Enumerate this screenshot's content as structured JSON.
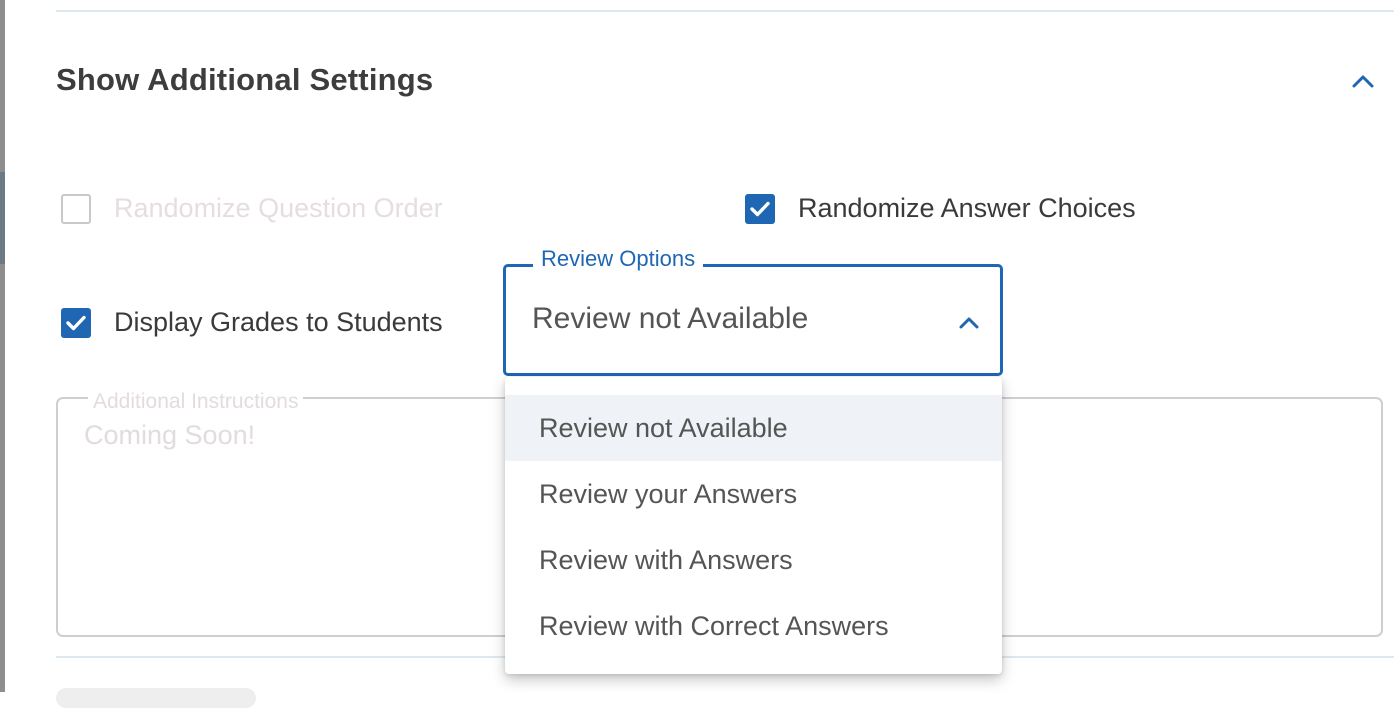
{
  "section": {
    "title": "Show Additional Settings",
    "collapse_icon": "chevron-up-icon"
  },
  "options": {
    "randomize_question_order": {
      "label": "Randomize Question Order",
      "checked": false,
      "disabled": true
    },
    "randomize_answer_choices": {
      "label": "Randomize Answer Choices",
      "checked": true
    },
    "display_grades": {
      "label": "Display Grades to Students",
      "checked": true
    }
  },
  "review_options": {
    "label": "Review Options",
    "selected": "Review not Available",
    "expanded": true,
    "options": [
      "Review not Available",
      "Review your Answers",
      "Review with Answers",
      "Review with Correct Answers"
    ]
  },
  "additional_instructions": {
    "label": "Additional Instructions",
    "placeholder": "Coming Soon!"
  },
  "colors": {
    "accent": "#1f66b3",
    "disabled_text": "#e6dede",
    "divider": "#dde9f1",
    "selected_option_bg": "#eff3f7"
  }
}
